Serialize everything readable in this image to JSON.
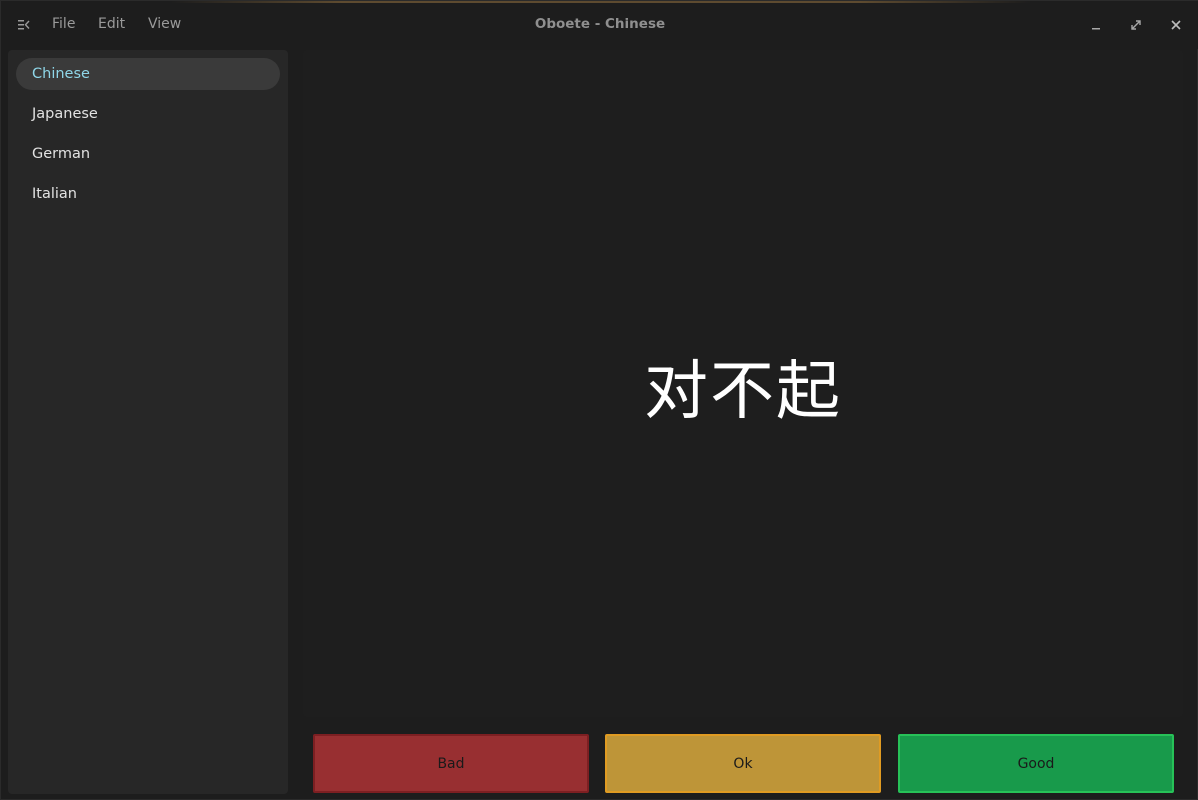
{
  "window": {
    "title": "Oboete - Chinese",
    "menu": [
      "File",
      "Edit",
      "View"
    ],
    "controls": [
      "minimize-icon",
      "maximize-icon",
      "close-icon"
    ]
  },
  "sidebar": {
    "items": [
      {
        "label": "Chinese",
        "selected": true
      },
      {
        "label": "Japanese",
        "selected": false
      },
      {
        "label": "German",
        "selected": false
      },
      {
        "label": "Italian",
        "selected": false
      }
    ]
  },
  "flashcard": {
    "front_text": "对不起"
  },
  "rating": {
    "bad_label": "Bad",
    "ok_label": "Ok",
    "good_label": "Good"
  },
  "colors": {
    "bad": "#982f31",
    "ok": "#be9538",
    "good": "#189a4b",
    "selected_text": "#8fd6e8"
  }
}
